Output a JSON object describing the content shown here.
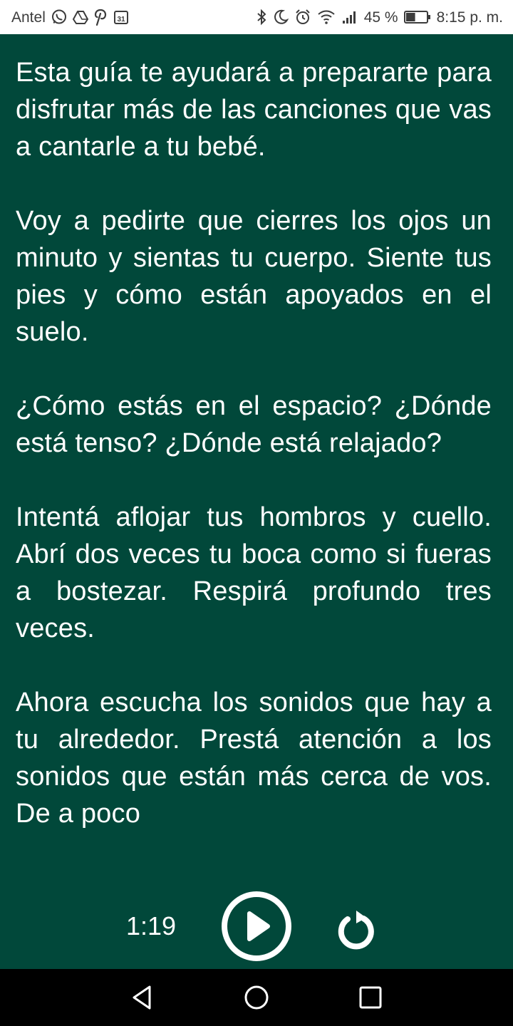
{
  "status_bar": {
    "carrier": "Antel",
    "battery_percent": "45 %",
    "time": "8:15 p. m.",
    "icons": [
      "whatsapp-icon",
      "drive-icon",
      "pinterest-icon",
      "calendar-icon",
      "bluetooth-icon",
      "moon-icon",
      "alarm-icon",
      "wifi-icon",
      "signal-icon",
      "battery-icon"
    ],
    "calendar_day": "31",
    "battery_level": 0.45
  },
  "content": {
    "paragraphs": [
      "Esta guía te ayudará a prepararte para disfrutar más de las canciones que vas a cantarle a tu bebé.",
      "Voy a pedirte que cierres los ojos un minuto y sientas tu cuerpo. Siente tus pies y cómo están apoyados en el suelo.",
      "¿Cómo estás en el espacio? ¿Dónde está tenso? ¿Dónde está relajado?",
      "Intentá aflojar tus hombros y cuello. Abrí dos veces tu boca como si fueras a bostezar. Respirá profundo tres veces.",
      "Ahora escucha los sonidos que hay a tu alrededor. Prestá atención a los sonidos que están más cerca de vos. De a poco"
    ]
  },
  "player": {
    "elapsed": "1:19",
    "play_icon": "play-icon",
    "replay_icon": "replay-icon"
  },
  "nav_bar": {
    "back_icon": "back-triangle-icon",
    "home_icon": "home-circle-icon",
    "recents_icon": "recents-square-icon"
  },
  "colors": {
    "background": "#01483a",
    "text": "#ffffff",
    "status_bar_bg": "#ffffff",
    "nav_bar_bg": "#000000"
  }
}
